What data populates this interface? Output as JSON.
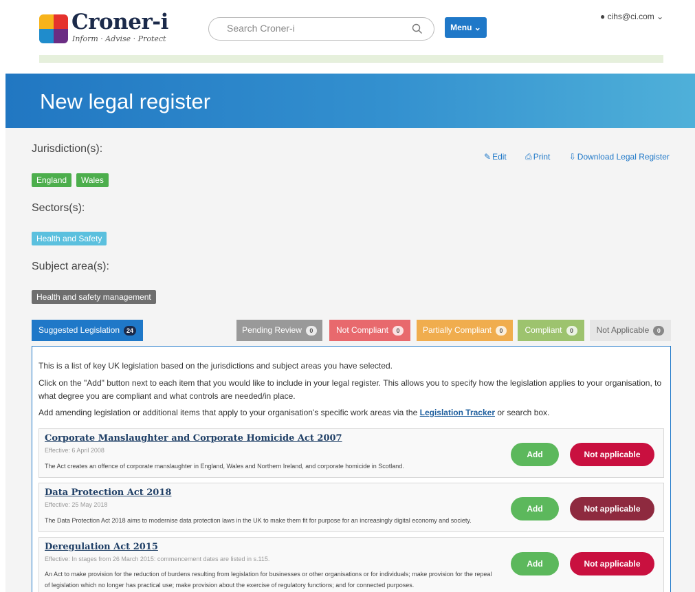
{
  "header": {
    "logo_name": "Croner-i",
    "logo_tagline": "Inform · Advise · Protect",
    "search_placeholder": "Search Croner-i",
    "menu_label": "Menu ⌄",
    "user_label": "cihs@ci.com ⌄"
  },
  "banner": {
    "title": "New legal register"
  },
  "meta": {
    "jurisdiction_label": "Jurisdiction(s):",
    "jurisdictions": [
      "England",
      "Wales"
    ],
    "sectors_label": "Sectors(s):",
    "sectors": [
      "Health and Safety"
    ],
    "subject_label": "Subject area(s):",
    "subjects": [
      "Health and safety management"
    ]
  },
  "actions": {
    "edit": "Edit",
    "print": "Print",
    "download": "Download Legal Register"
  },
  "tabs": [
    {
      "label": "Suggested Legislation",
      "count": "24"
    },
    {
      "label": "Pending Review",
      "count": "0"
    },
    {
      "label": "Not Compliant",
      "count": "0"
    },
    {
      "label": "Partially Compliant",
      "count": "0"
    },
    {
      "label": "Compliant",
      "count": "0"
    },
    {
      "label": "Not Applicable",
      "count": "0"
    }
  ],
  "intro": {
    "p1": "This is a list of key UK legislation based on the jurisdictions and subject areas you have selected.",
    "p2": "Click on the \"Add\" button next to each item that you would like to include in your legal register. This allows you to specify how the legislation applies to your organisation, to what degree you are compliant and what controls are needed/in place.",
    "p3_before": "Add amending legislation or additional items that apply to your organisation's specific work areas via the ",
    "p3_link": "Legislation Tracker",
    "p3_after": " or search box."
  },
  "items": [
    {
      "title": "Corporate Manslaughter and Corporate Homicide Act 2007",
      "effective": "Effective: 6 April 2008",
      "description": "The Act creates an offence of corporate manslaughter in England, Wales and Northern Ireland, and corporate homicide in Scotland.",
      "add_label": "Add",
      "na_label": "Not applicable"
    },
    {
      "title": "Data Protection Act 2018",
      "effective": "Effective: 25 May 2018",
      "description": "The Data Protection Act 2018 aims to modernise data protection laws in the UK to make them fit for purpose for an increasingly digital economy and society.",
      "add_label": "Add",
      "na_label": "Not applicable"
    },
    {
      "title": "Deregulation Act 2015",
      "effective": "Effective: In stages from 26 March 2015: commencement dates are listed in s.115.",
      "description": "An Act to make provision for the reduction of burdens resulting from legislation for businesses or other organisations or for individuals; make provision for the repeal of legislation which no longer has practical use; make provision about the exercise of regulatory functions; and for connected purposes.",
      "add_label": "Add",
      "na_label": "Not applicable"
    }
  ],
  "colors": {
    "primary": "#1f78c8",
    "add_button": "#5cb85c",
    "not_applicable_button": "#c9103f",
    "jurisdiction_tag": "#4cae4c",
    "sector_tag": "#5bc0de",
    "subject_tag": "#6e6e6e"
  }
}
